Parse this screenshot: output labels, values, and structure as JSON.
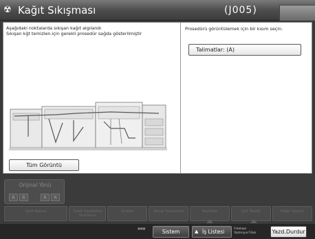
{
  "titlebar": {
    "icon": "printer-jam-icon",
    "title": "Kağıt Sıkışması",
    "code": "(J005)"
  },
  "left_pane": {
    "message_line1": "Aşağıdaki noktalarda sıkışan kağıt algılandı",
    "message_line2": "Sıkışan kğt temizlen.için gerekli prosedür sağda gösterilmiştir",
    "all_view_button": "Tüm Görüntü"
  },
  "right_pane": {
    "message": "Prosedürü görüntülemek için bir kısım seçin.",
    "instruction_button": "Talimatlar: (A)"
  },
  "bottom": {
    "orientation_label": "Orijinal Yönü",
    "orient_icon1": "R",
    "orient_icon2": "R",
    "orient_icon3": "R",
    "orient_icon4": "R",
    "dim_buttons": [
      "Gizli Kopya",
      "Sabit Kaydırma Sıralama",
      "Sıralar",
      "Kenar Kaydırma",
      "Sayfalar",
      "Çift Taraflı",
      "Kağıt Seçimi"
    ]
  },
  "statusbar": {
    "small_text": "■■■",
    "system_button": "Sistem Durumu",
    "job_button": "İş Listesi",
    "copier_text_line1": "Fotokopi",
    "copier_text_line2": "Yazdırıyor-Tdak",
    "stop_button": "Yazd.Durdur"
  },
  "colors": {
    "title_bg": "#4e4e4e",
    "panel_bg": "#ffffff",
    "bottom_bg": "#3b3b3b",
    "status_bg": "#262626"
  }
}
